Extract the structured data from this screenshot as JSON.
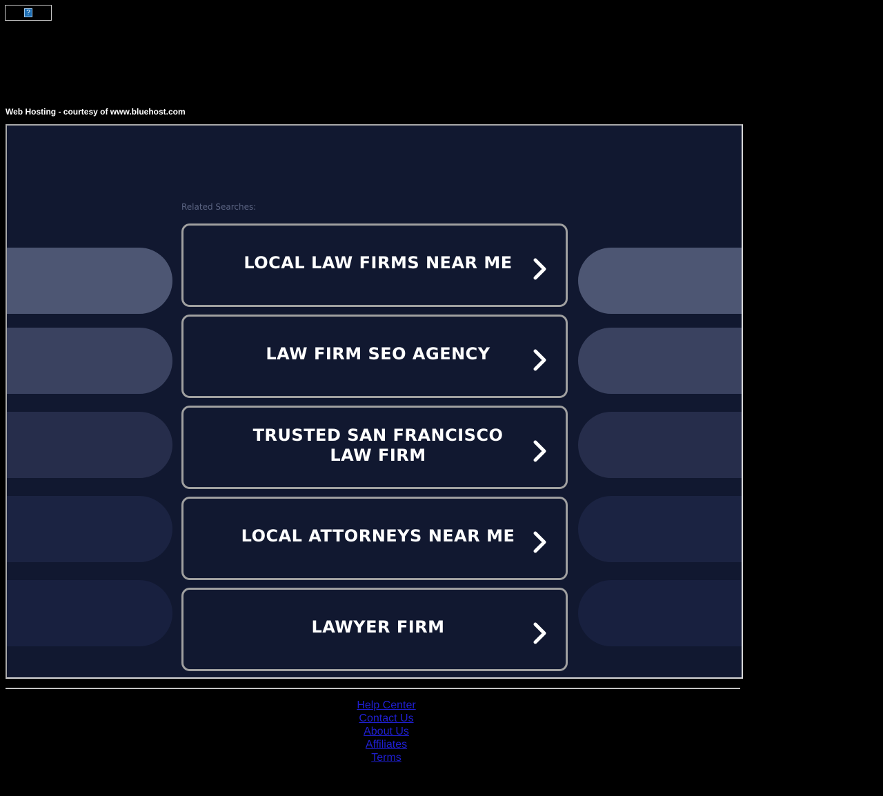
{
  "banner": {
    "broken_image_glyph": "?"
  },
  "hosting_text": "Web Hosting - courtesy of www.bluehost.com",
  "related": {
    "label": "Related Searches:",
    "items": [
      {
        "label": "LOCAL LAW FIRMS NEAR ME"
      },
      {
        "label": "LAW FIRM SEO AGENCY"
      },
      {
        "label": "TRUSTED SAN FRANCISCO LAW FIRM"
      },
      {
        "label": "LOCAL ATTORNEYS NEAR ME"
      },
      {
        "label": "LAWYER FIRM"
      }
    ]
  },
  "colors": {
    "page_background": "#000000",
    "frame_background": "#111830",
    "card_border": "#a0a0a0",
    "pill_shades": [
      "#4d5673",
      "#3a4260",
      "#262d4b",
      "#1b2342",
      "#18203f"
    ],
    "link": "#1f1fd2"
  },
  "icons": {
    "card_arrow": "chevron-right-icon"
  },
  "footer": {
    "links": [
      {
        "label": "Help Center"
      },
      {
        "label": "Contact Us"
      },
      {
        "label": "About Us"
      },
      {
        "label": "Affiliates"
      },
      {
        "label": "Terms"
      }
    ]
  }
}
